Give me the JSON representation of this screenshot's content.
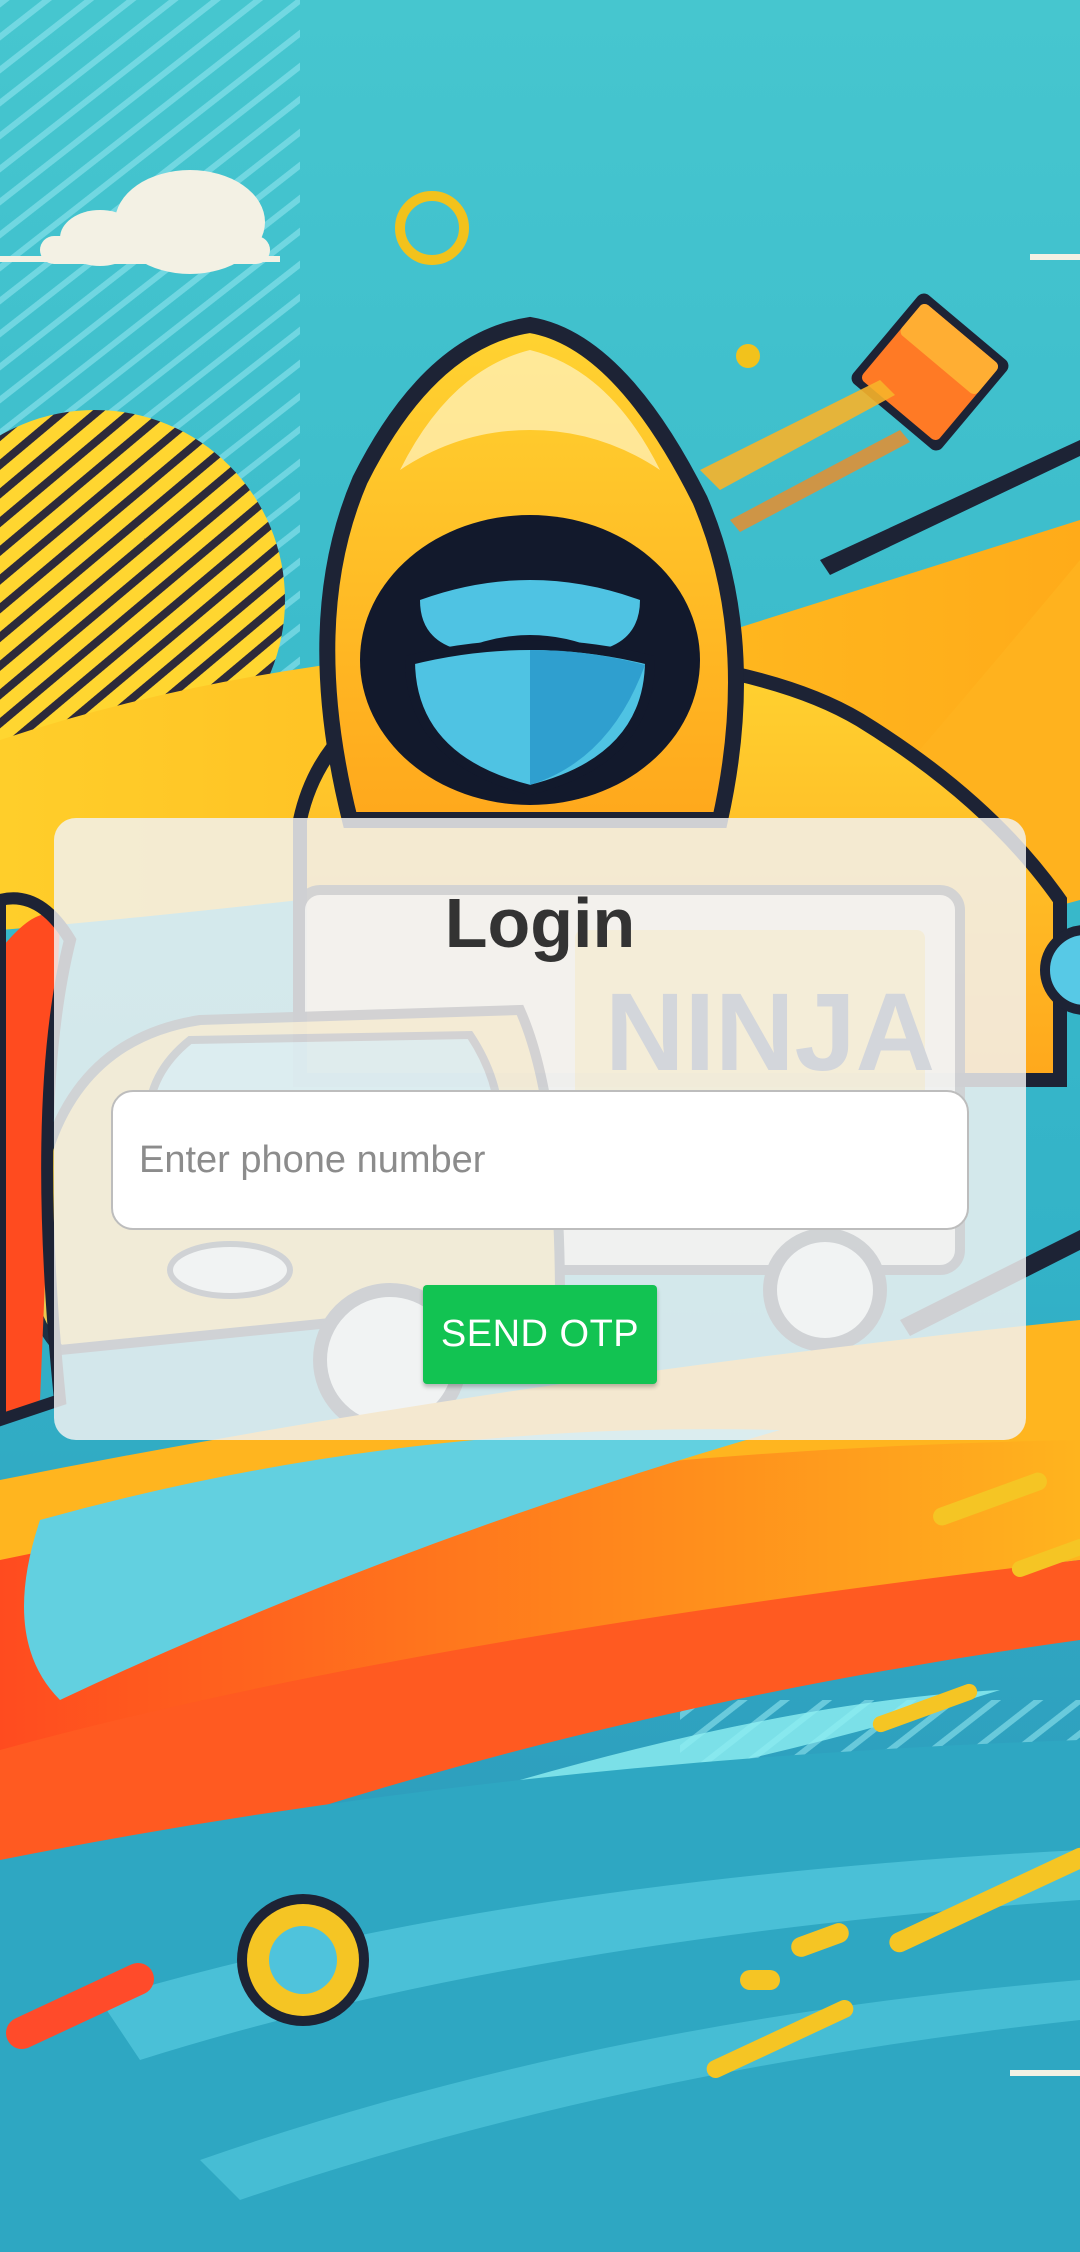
{
  "background": {
    "illustration": "ninja-delivery-artwork",
    "logo_text": "NINJA"
  },
  "login": {
    "title": "Login",
    "phone_placeholder": "Enter phone number",
    "phone_value": "",
    "send_otp_label": "SEND OTP"
  },
  "colors": {
    "card": "#f2f2f2",
    "button": "#12c352",
    "title": "#333333",
    "placeholder": "#8c8c8c"
  }
}
